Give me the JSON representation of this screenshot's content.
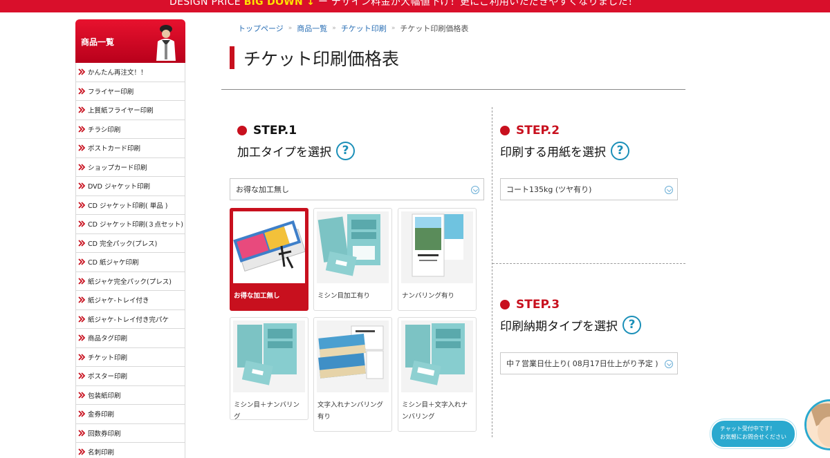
{
  "topbar": {
    "text_prefix": "DESIGN PRICE",
    "text_highlight": "BIG DOWN ↓",
    "text_suffix": "ー デザイン料金が大幅値下げ！更にご利用いただきやすくなりました！"
  },
  "sidebar": {
    "title": "商品一覧",
    "items": [
      {
        "label": "かんたん再注文！！"
      },
      {
        "label": "フライヤー印刷"
      },
      {
        "label": "上質紙フライヤー印刷"
      },
      {
        "label": "チラシ印刷"
      },
      {
        "label": "ポストカード印刷"
      },
      {
        "label": "ショップカード印刷"
      },
      {
        "label": "DVD ジャケット印刷"
      },
      {
        "label": "CD ジャケット印刷( 単品 )"
      },
      {
        "label": "CD ジャケット印刷(３点セット)"
      },
      {
        "label": "CD 完全パック(プレス)"
      },
      {
        "label": "CD 紙ジャケ印刷"
      },
      {
        "label": "紙ジャケ完全パック(プレス)"
      },
      {
        "label": "紙ジャケ-トレイ付き"
      },
      {
        "label": "紙ジャケ-トレイ付き完パケ"
      },
      {
        "label": "商品タグ印刷"
      },
      {
        "label": "チケット印刷"
      },
      {
        "label": "ポスター印刷"
      },
      {
        "label": "包装紙印刷"
      },
      {
        "label": "金券印刷"
      },
      {
        "label": "回数券印刷"
      },
      {
        "label": "名刺印刷"
      }
    ]
  },
  "breadcrumb": {
    "items": [
      "トップページ",
      "商品一覧",
      "チケット印刷"
    ],
    "separator": "»",
    "current": "チケット印刷価格表"
  },
  "page": {
    "title": "チケット印刷価格表"
  },
  "colors": {
    "accent": "#c8101e",
    "help": "#1a8fb8",
    "link": "#2a6fb5"
  },
  "step1": {
    "label": "STEP.1",
    "subtitle": "加工タイプを選択",
    "help": "?",
    "select_value": "お得な加工無し",
    "options": [
      {
        "label": "お得な加工無し",
        "selected": true
      },
      {
        "label": "ミシン目加工有り",
        "selected": false
      },
      {
        "label": "ナンバリング有り",
        "selected": false
      },
      {
        "label": "ミシン目＋ナンバリング",
        "selected": false
      },
      {
        "label": "文字入れナンバリング有り",
        "selected": false
      },
      {
        "label": "ミシン目＋文字入れナンバリング",
        "selected": false
      }
    ]
  },
  "step2": {
    "label": "STEP.2",
    "subtitle": "印刷する用紙を選択",
    "help": "?",
    "select_value": "コート135kg (ツヤ有り)"
  },
  "step3": {
    "label": "STEP.3",
    "subtitle": "印刷納期タイプを選択",
    "help": "?",
    "select_value": "中７営業日仕上り( 08月17日仕上がり予定 )"
  },
  "chat": {
    "line1": "チャット受付中です！",
    "line2": "お気軽にお問合せください"
  }
}
